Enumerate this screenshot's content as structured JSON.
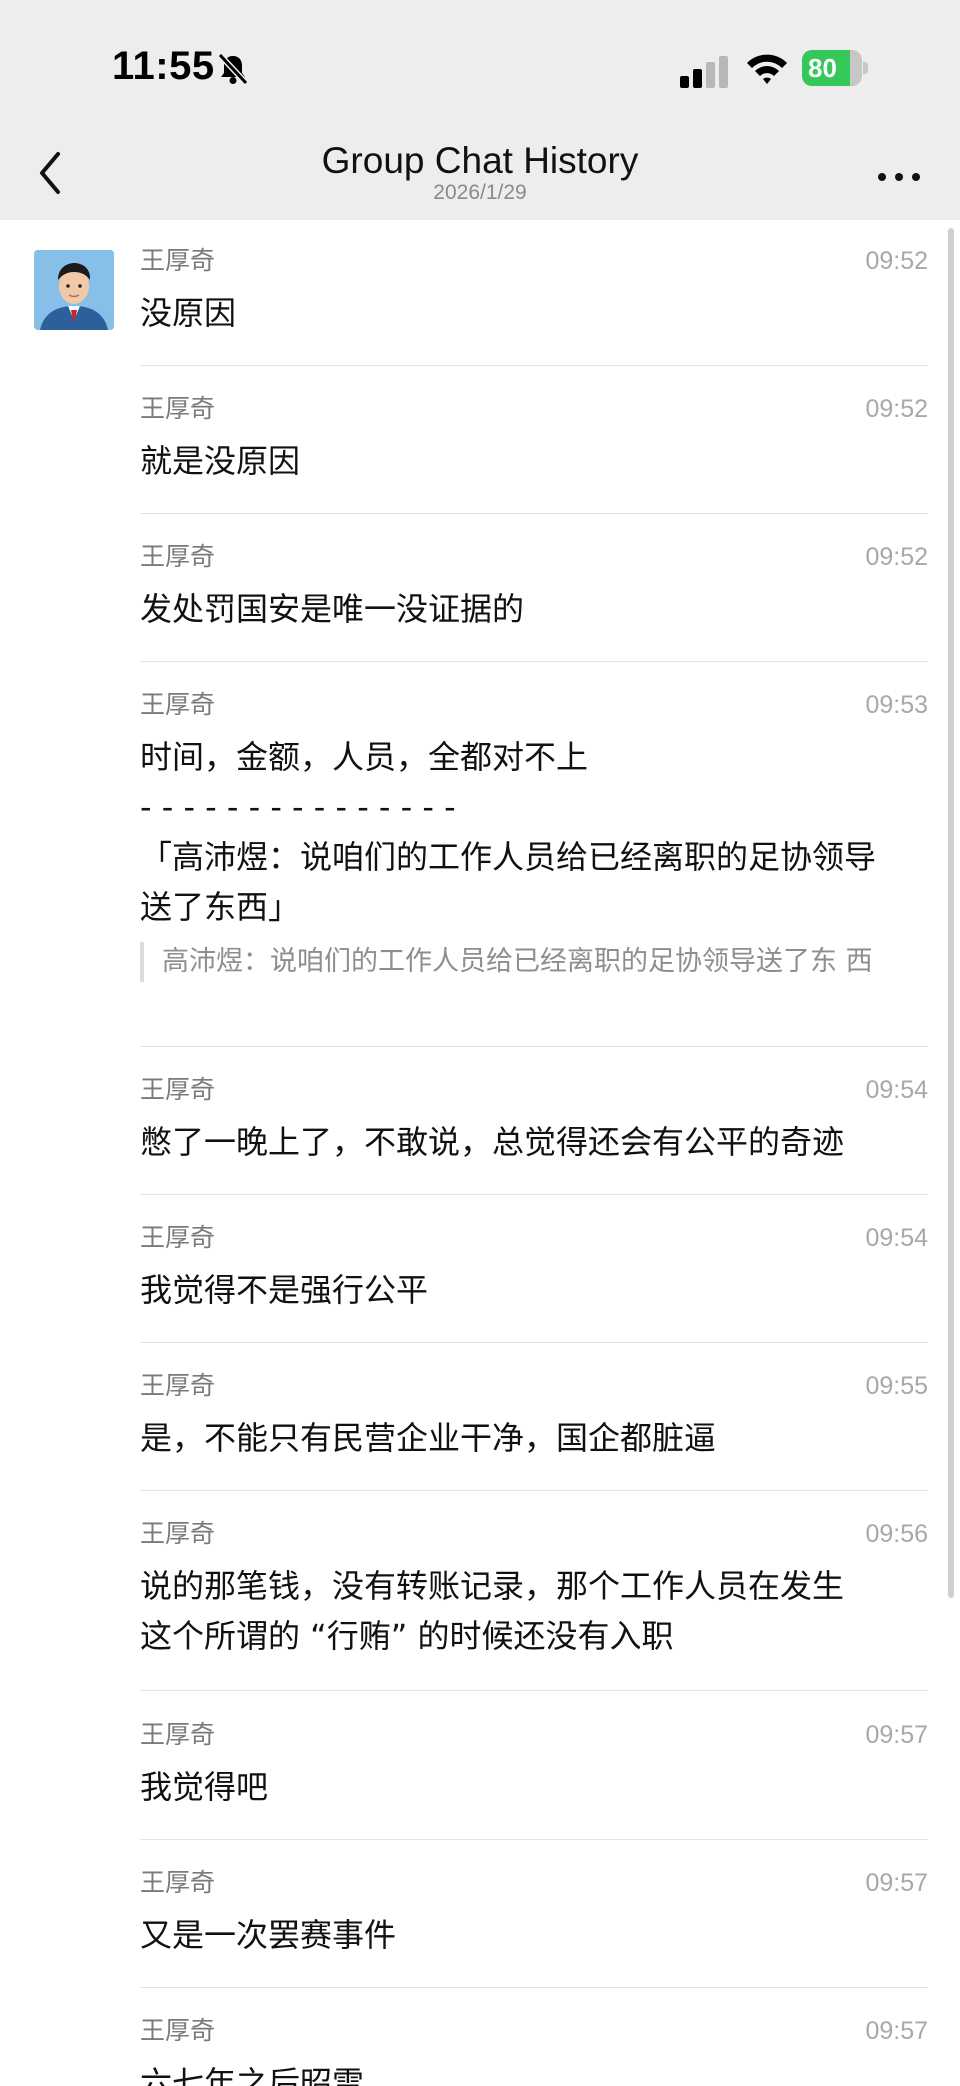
{
  "status_bar": {
    "time": "11:55",
    "battery_percent": "80",
    "battery_level": 0.8,
    "icons": [
      "bell-muted-icon",
      "signal-icon",
      "wifi-icon",
      "battery-charging-icon"
    ]
  },
  "nav": {
    "title": "Group Chat History",
    "date": "2026/1/29",
    "back_icon": "chevron-left-icon",
    "more_icon": "ellipsis-icon"
  },
  "messages": [
    {
      "sender": "王厚奇",
      "time": "09:52",
      "text": "没原因"
    },
    {
      "sender": "王厚奇",
      "time": "09:52",
      "text": "就是没原因"
    },
    {
      "sender": "王厚奇",
      "time": "09:52",
      "text": "发处罚国安是唯一没证据的"
    },
    {
      "sender": "王厚奇",
      "time": "09:53",
      "text": "时间，金额，人员，全都对不上\n- - - - - - - - - - - - - - -\n「高沛煜：说咱们的工作人员给已经离职的足协领导\n送了东西」",
      "quote": "高沛煜：说咱们的工作人员给已经离职的足协领导送了东\n西"
    },
    {
      "sender": "王厚奇",
      "time": "09:54",
      "text": "憋了一晚上了，不敢说，总觉得还会有公平的奇迹"
    },
    {
      "sender": "王厚奇",
      "time": "09:54",
      "text": "我觉得不是强行公平"
    },
    {
      "sender": "王厚奇",
      "time": "09:55",
      "text": "是，不能只有民营企业干净，国企都脏逼"
    },
    {
      "sender": "王厚奇",
      "time": "09:56",
      "text": "说的那笔钱，没有转账记录，那个工作人员在发生\n这个所谓的 “行贿” 的时候还没有入职"
    },
    {
      "sender": "王厚奇",
      "time": "09:57",
      "text": "我觉得吧"
    },
    {
      "sender": "王厚奇",
      "time": "09:57",
      "text": "又是一次罢赛事件"
    },
    {
      "sender": "王厚奇",
      "time": "09:57",
      "text": "六七年之后昭雪"
    }
  ],
  "colors": {
    "header_bg": "#ededed",
    "battery_green": "#34c759",
    "sender_gray": "#7a7a7a",
    "time_gray": "#a8a8a8"
  }
}
